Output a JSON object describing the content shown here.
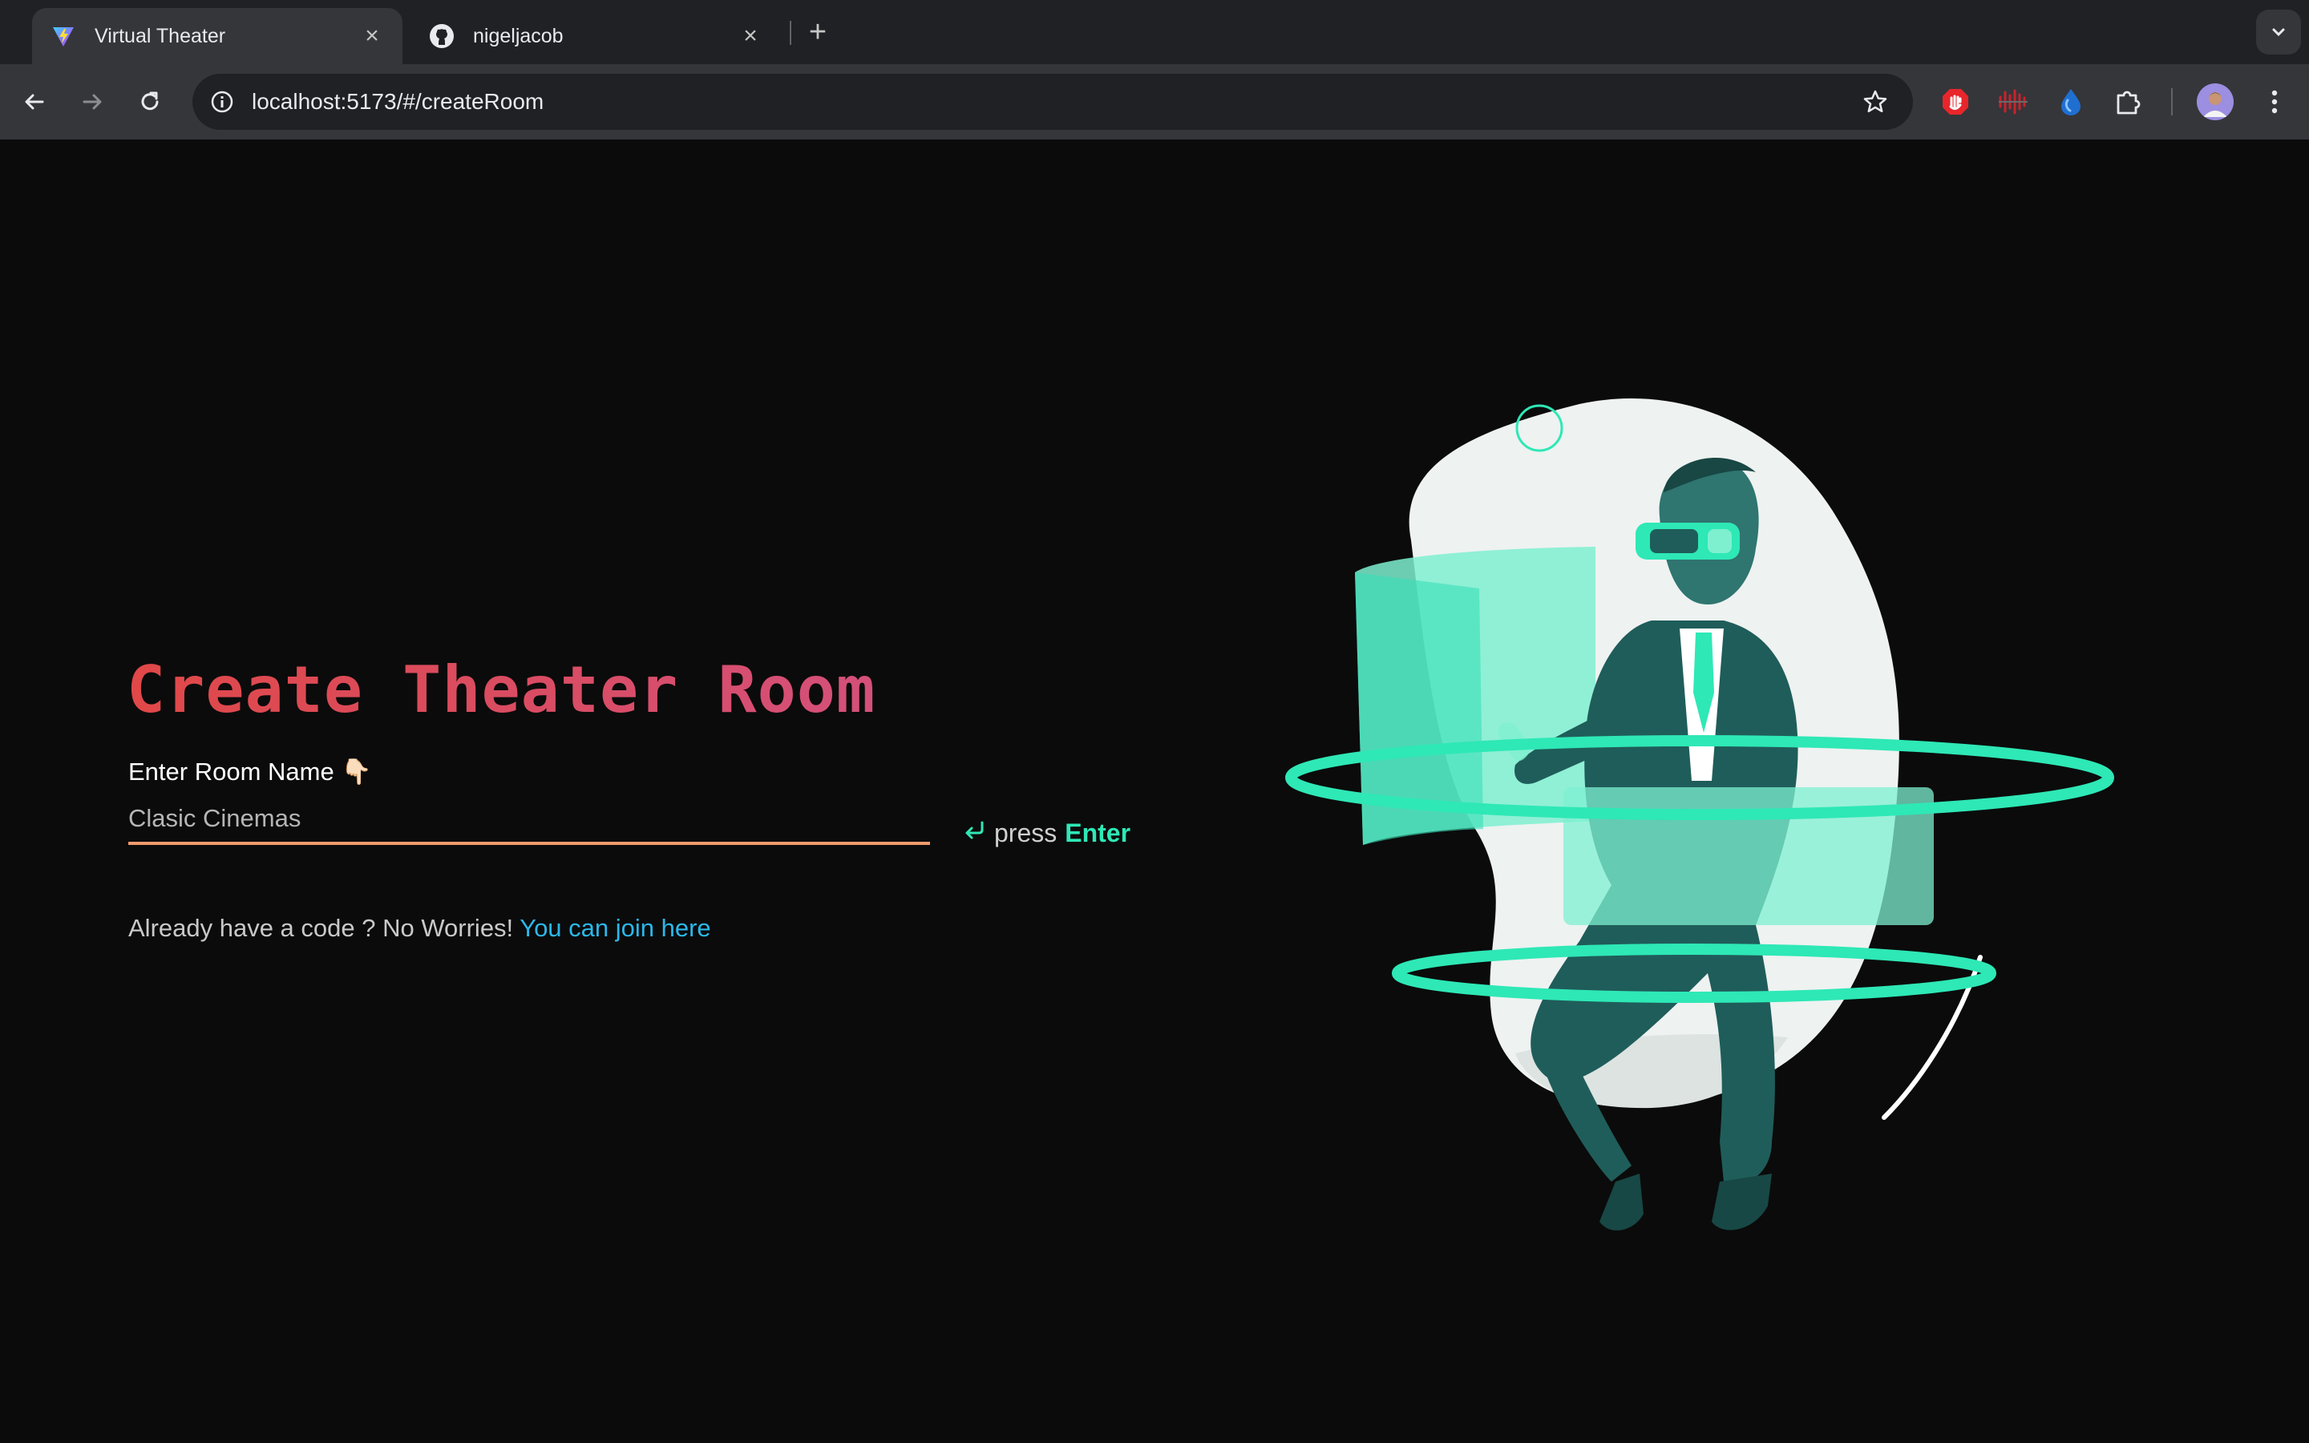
{
  "browser": {
    "tabs": [
      {
        "title": "Virtual Theater",
        "active": true,
        "favicon": "vite-icon"
      },
      {
        "title": "nigeljacob",
        "active": false,
        "favicon": "github-icon"
      }
    ],
    "address": "localhost:5173/#/createRoom",
    "extensions": [
      "adblock-icon",
      "audio-wave-icon",
      "drop-icon",
      "puzzle-icon"
    ]
  },
  "page": {
    "heading": "Create Theater Room",
    "input_label": "Enter Room Name 👇🏻",
    "input_placeholder": "Clasic Cinemas",
    "press_text": "press",
    "press_key": "Enter",
    "already_text": "Already have a code ? No Worries!",
    "join_link": "You can join here"
  },
  "colors": {
    "background": "#0b0b0b",
    "heading_start": "#e04848",
    "heading_end": "#d4507a",
    "input_underline": "#f09a6c",
    "accent_teal": "#2ee8b6",
    "link": "#2bb8ea"
  }
}
